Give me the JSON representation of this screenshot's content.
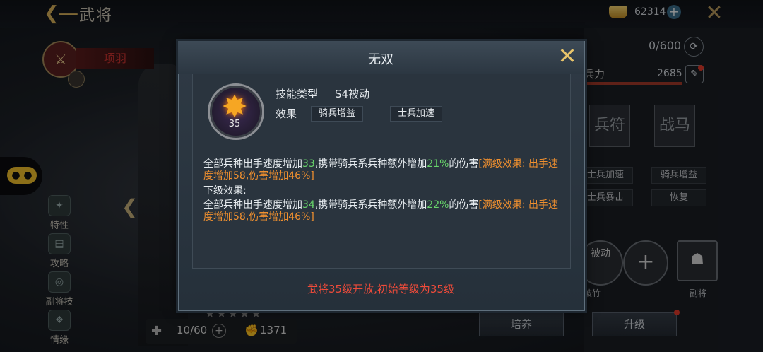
{
  "topbar": {
    "title": "武将",
    "gold_count": "62314"
  },
  "hero": {
    "name": "项羽",
    "stars": "★★★★★",
    "fragments": "10/60",
    "power": "1371"
  },
  "sidebar": {
    "items": [
      {
        "label": "特性"
      },
      {
        "label": "攻略"
      },
      {
        "label": "副将技"
      },
      {
        "label": "情缘"
      }
    ]
  },
  "right": {
    "soldier_count": "0/600",
    "troop_label": "兵力",
    "troop_value": "2685",
    "slots": [
      "兵符",
      "战马"
    ],
    "chips": [
      "士兵加速",
      "骑兵增益",
      "士兵暴击",
      "恢复"
    ],
    "skill_label": "破竹",
    "vice_label": "副将",
    "train_button": "培养",
    "upgrade_button": "升级",
    "passive_badge": "被动"
  },
  "modal": {
    "title": "无双",
    "skill_level": "35",
    "type_label": "技能类型",
    "type_value": "S4被动",
    "effect_label": "效果",
    "effect_tags": [
      "骑兵增益",
      "士兵加速"
    ],
    "current": {
      "p1": "全部兵种出手速度增加",
      "v1": "33",
      "p2": ",携带骑兵系兵种额外增加",
      "v2": "21%",
      "p3": "的伤害",
      "max": "[满级效果: 出手速度增加58,伤害增加46%]"
    },
    "next_label": "下级效果:",
    "next": {
      "p1": "全部兵种出手速度增加",
      "v1": "34",
      "p2": ",携带骑兵系兵种额外增加",
      "v2": "22%",
      "p3": "的伤害",
      "max": "[满级效果: 出手速度增加58,伤害增加46%]"
    },
    "unlock_note": "武将35级开放,初始等级为35级"
  },
  "colors": {
    "accent_gold": "#e8c46a",
    "value_green": "#67d36a",
    "max_orange": "#f0902f",
    "note_red": "#ef4b3a"
  }
}
